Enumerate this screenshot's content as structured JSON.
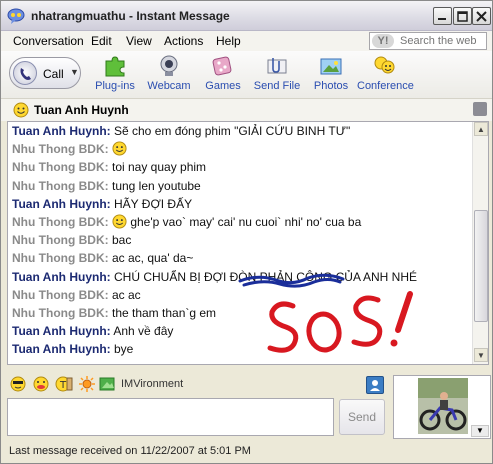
{
  "window": {
    "title": "nhatrangmuathu - Instant Message",
    "colors": {
      "title_bar": "#dcdbe4",
      "tuan_sender": "#1c2a72",
      "nhu_sender": "#8a8a8a",
      "scribble_red": "#d81820",
      "scribble_blue": "#1a2e9a"
    }
  },
  "menu": {
    "items": [
      "Conversation",
      "Edit",
      "View",
      "Actions",
      "Help"
    ],
    "search_placeholder": "Search the web"
  },
  "toolbar": {
    "call_label": "Call",
    "tools": [
      {
        "label": "Plug-ins",
        "icon": "puzzle-icon"
      },
      {
        "label": "Webcam",
        "icon": "webcam-icon"
      },
      {
        "label": "Games",
        "icon": "dice-icon"
      },
      {
        "label": "Send File",
        "icon": "paperclip-icon"
      },
      {
        "label": "Photos",
        "icon": "photo-icon"
      },
      {
        "label": "Conference",
        "icon": "conference-icon"
      }
    ]
  },
  "contact": {
    "name": "Tuan Anh Huynh"
  },
  "conversation": [
    {
      "sender": "Tuan Anh Huynh:",
      "who": "tuan",
      "text": "Sẽ cho em đóng phim \"GIẢI CỨU BINH TƯ\""
    },
    {
      "sender": "Nhu Thong BDK:",
      "who": "nhu",
      "text": "",
      "emoticon": "smile"
    },
    {
      "sender": "Nhu Thong BDK:",
      "who": "nhu",
      "text": "toi nay quay phim"
    },
    {
      "sender": "Nhu Thong BDK:",
      "who": "nhu",
      "text": "tung len youtube"
    },
    {
      "sender": "Tuan Anh Huynh:",
      "who": "tuan",
      "text": "HÃY ĐỢI ĐẤY"
    },
    {
      "sender": "Nhu Thong BDK:",
      "who": "nhu",
      "text": "ghe'p vao` may' cai' nu cuoi` nhi' no' cua ba",
      "emoticon": "smile"
    },
    {
      "sender": "Nhu Thong BDK:",
      "who": "nhu",
      "text": "bac"
    },
    {
      "sender": "Nhu Thong BDK:",
      "who": "nhu",
      "text": "ac ac, qua' da~"
    },
    {
      "sender": "Tuan Anh Huynh:",
      "who": "tuan",
      "text": "CHÚ CHUẨN BỊ ĐỢI ĐÒN PHẢN CÔNG CỦA ANH NHÉ"
    },
    {
      "sender": "Nhu Thong BDK:",
      "who": "nhu",
      "text": "ac ac"
    },
    {
      "sender": "Nhu Thong BDK:",
      "who": "nhu",
      "text": "the tham than`g em"
    },
    {
      "sender": "Tuan Anh Huynh:",
      "who": "tuan",
      "text": "Anh về đây"
    },
    {
      "sender": "Tuan Anh Huynh:",
      "who": "tuan",
      "text": "bye"
    }
  ],
  "emoticon_bar": {
    "icons": [
      "smiley-sunglasses-icon",
      "smiley-tongue-icon",
      "smiley-clock-icon",
      "sun-icon",
      "imvironment-icon"
    ],
    "imvironment_label": "IMVironment"
  },
  "input": {
    "send_label": "Send"
  },
  "status": {
    "text": "Last message received on 11/22/2007 at 5:01 PM"
  }
}
